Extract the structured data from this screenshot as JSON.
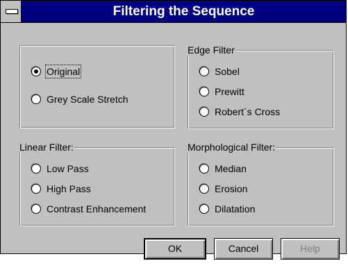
{
  "window": {
    "title": "Filtering the Sequence",
    "system_menu_icon": "system-menu-icon"
  },
  "groups": {
    "preprocess": {
      "options": [
        {
          "label": "Original",
          "checked": true,
          "focused": true
        },
        {
          "label": "Grey Scale Stretch",
          "checked": false
        }
      ]
    },
    "edge": {
      "legend": "Edge Filter",
      "options": [
        {
          "label": "Sobel",
          "checked": false
        },
        {
          "label": "Prewitt",
          "checked": false
        },
        {
          "label": "Robert´s Cross",
          "checked": false
        }
      ]
    },
    "linear": {
      "legend": "Linear Filter:",
      "options": [
        {
          "label": "Low Pass",
          "checked": false
        },
        {
          "label": "High Pass",
          "checked": false
        },
        {
          "label": "Contrast Enhancement",
          "checked": false
        }
      ]
    },
    "morphological": {
      "legend": "Morphological Filter:",
      "options": [
        {
          "label": "Median",
          "checked": false
        },
        {
          "label": "Erosion",
          "checked": false
        },
        {
          "label": "Dilatation",
          "checked": false
        }
      ]
    }
  },
  "buttons": {
    "ok": {
      "label": "OK",
      "enabled": true,
      "default": true
    },
    "cancel": {
      "label": "Cancel",
      "enabled": true
    },
    "help": {
      "label": "Help",
      "enabled": false
    }
  },
  "colors": {
    "titlebar": "#000080",
    "face": "#c0c0c0",
    "disabled_text": "#808080"
  }
}
